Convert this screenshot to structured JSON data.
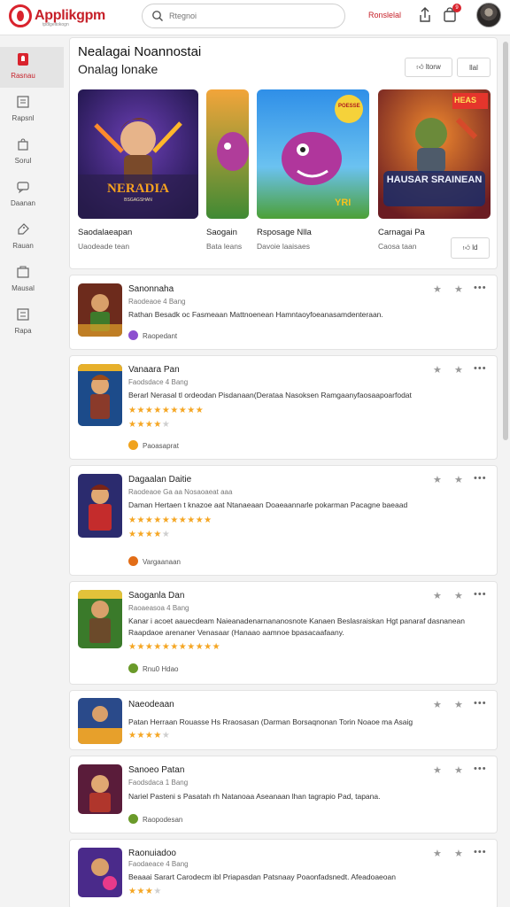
{
  "header": {
    "logo_text": "Applikgpm",
    "logo_sub": "tpdlgeltokogn",
    "search_placeholder": "Rtegnoi",
    "link_label": "Ronslelal",
    "notif_count": "9"
  },
  "sidebar": {
    "items": [
      {
        "label": "Rasnau",
        "icon": "home-icon",
        "active": true
      },
      {
        "label": "Rapsnl",
        "icon": "list-icon",
        "active": false
      },
      {
        "label": "Sorul",
        "icon": "bag-icon",
        "active": false
      },
      {
        "label": "Daanan",
        "icon": "chat-icon",
        "active": false
      },
      {
        "label": "Rauan",
        "icon": "tag-icon",
        "active": false
      },
      {
        "label": "Mausal",
        "icon": "box-icon",
        "active": false
      },
      {
        "label": "Rapa",
        "icon": "grid-icon",
        "active": false
      }
    ]
  },
  "featured": {
    "title": "Nealagai Noannostai",
    "subtitle": "Onalag lonake",
    "like_label": "ltorw",
    "more_label": "llal",
    "like2_label": "ld",
    "games": [
      {
        "name": "Saodalaeapan",
        "dev": "Uaodeade tean",
        "art_text": "NERADIA",
        "art_sub": "BSGAGSHAN"
      },
      {
        "name": "Saogain",
        "dev": "Bata leans",
        "art_text": "",
        "art_sub": ""
      },
      {
        "name": "Rsposage Nlla",
        "dev": "Davoie laaisaes",
        "art_text": "YRI",
        "art_sub": "POESSE"
      },
      {
        "name": "Carnagai Pa",
        "dev": "Caosa taan",
        "art_text": "HAUSAR SRAINEAN",
        "art_sub": "HEAS"
      }
    ]
  },
  "list": [
    {
      "title": "Sanonnaha",
      "meta": "Raodeaoe  4  Bang",
      "desc": "Rathan Besadk oc Fasmeaan Mattnoenean Hamntaoyfoeanasamdenteraan.",
      "stars_on": 0,
      "stars_off": 0,
      "extra_stars": false,
      "source": "Raopedant",
      "source_color": "#8c4fcf"
    },
    {
      "title": "Vanaara Pan",
      "meta": "Faodsdace  4  Bang",
      "desc": "Berarl Nerasal tl ordeodan Pisdanaan(Derataa Nasoksen Ramgaanyfaosaapoarfodat",
      "stars_on": 4,
      "stars_off": 1,
      "extra_stars": true,
      "source": "Paoasaprat",
      "source_color": "#f0a21c"
    },
    {
      "title": "Dagaalan Daitie",
      "meta": "Raodeaoe  Ga aa  Nosaoaeat aaa",
      "desc": "Daman Hertaen  t knazoe aat Ntanaeaan Doaeaannarle pokarman Pacagne baeaad",
      "stars_on": 4,
      "stars_off": 1,
      "extra_stars": true,
      "source": "Vargaanaan",
      "source_color": "#e26d17"
    },
    {
      "title": "Saoganla Dan",
      "meta": "Raoaeasoa  4  Bang",
      "desc": "Kanar i acoet aauecdeam Naieanadenarnananosnote Kanaen Beslasraiskan Hgt panaraf dasnanean Raapdaoe arenaner Venasaar (Hanaao aamnoe bpasacaafaany.",
      "stars_on": 4,
      "stars_off": 0,
      "extra_stars": true,
      "source": "Rnu0 Hdao",
      "source_color": "#6a9a2a"
    },
    {
      "title": "Naeodeaan",
      "meta": "",
      "desc": "Patan Herraan Rouasse Hs Rraosasan (Darman Borsaqnonan Torin Noaoe ma Asaig",
      "stars_on": 4,
      "stars_off": 1,
      "extra_stars": false,
      "source": "",
      "source_color": "#f0a21c"
    },
    {
      "title": "Sanoeo Patan",
      "meta": "Faodsdaca  1  Bang",
      "desc": "Nariel Pasteni s Pasatah rh Natanoaa Aseanaan lhan tagrapio Pad, tapana.",
      "stars_on": 0,
      "stars_off": 0,
      "extra_stars": false,
      "source": "Raopodesan",
      "source_color": "#6a9a2a"
    },
    {
      "title": "Raonuiadoo",
      "meta": "Faodaeace  4  Bang",
      "desc": "Beaaai Sarart Carodecm ibl Priapasdan Patsnaay Poaonfadsnedt. Afeadoaeoan",
      "stars_on": 3,
      "stars_off": 1,
      "extra_stars": false,
      "source": "",
      "source_color": "#8c4fcf"
    }
  ]
}
